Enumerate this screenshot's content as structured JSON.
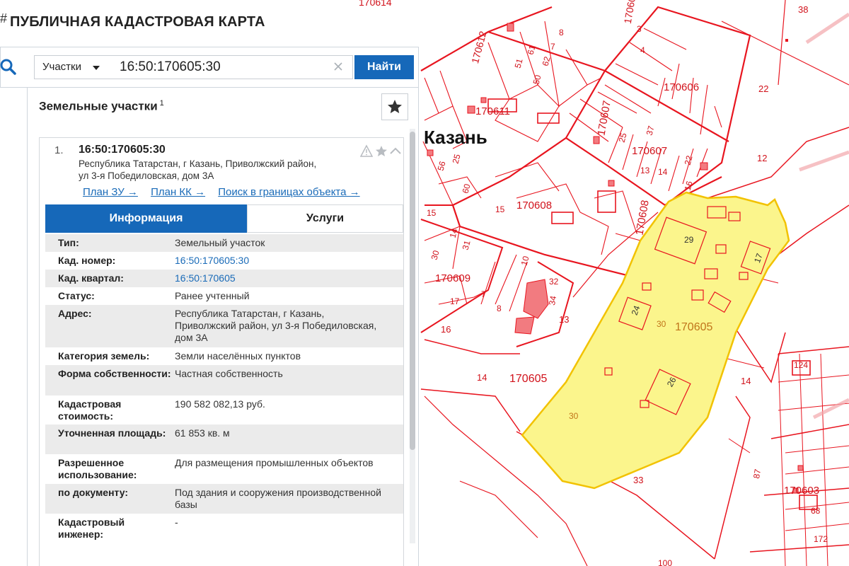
{
  "header": {
    "title": "ПУБЛИЧНАЯ КАДАСТРОВАЯ КАРТА",
    "mark": "#"
  },
  "search": {
    "layer": "Участки",
    "query": "16:50:170605:30",
    "button": "Найти"
  },
  "panel": {
    "title": "Земельные участки",
    "count": "1"
  },
  "result": {
    "index": "1.",
    "cad_number": "16:50:170605:30",
    "address": "Республика Татарстан, г Казань, Приволжский район, ул 3-я Победиловская, дом 3А",
    "links": [
      "План ЗУ →",
      "План КК →",
      "Поиск в границах объекта →"
    ],
    "tabs": {
      "info": "Информация",
      "services": "Услуги"
    },
    "rows": [
      {
        "label": "Тип:",
        "value": "Земельный участок"
      },
      {
        "label": "Кад. номер:",
        "value": "16:50:170605:30"
      },
      {
        "label": "Кад. квартал:",
        "value": "16:50:170605"
      },
      {
        "label": "Статус:",
        "value": "Ранее учтенный"
      },
      {
        "label": "Адрес:",
        "value": "Республика Татарстан, г Казань, Приволжский район, ул 3-я Победиловская, дом 3А"
      },
      {
        "label": "Категория земель:",
        "value": "Земли населённых пунктов"
      },
      {
        "label": "Форма собственности:",
        "value": "Частная собственность"
      },
      {
        "label": "Кадастровая стоимость:",
        "value": "190 582 082,13 руб."
      },
      {
        "label": "Уточненная площадь:",
        "value": "61 853 кв. м"
      },
      {
        "label": "Разрешенное использование:",
        "value": "Для размещения промышленных объектов"
      },
      {
        "label": "по документу:",
        "value": "Под здания и сооружения производственной базы"
      },
      {
        "label": "Кадастровый инженер:",
        "value": "-"
      }
    ]
  },
  "map": {
    "city": "Казань",
    "quarters": [
      "170614",
      "170612",
      "170611",
      "170607",
      "170606",
      "170607",
      "170608",
      "170608",
      "170609",
      "170605",
      "170605",
      "170603",
      "17060"
    ],
    "parcels": [
      "38",
      "22",
      "12",
      "29",
      "17",
      "24",
      "30",
      "30",
      "26",
      "30",
      "33",
      "14",
      "14",
      "13",
      "16",
      "32",
      "34",
      "15",
      "124",
      "87",
      "68",
      "172",
      "100",
      "56",
      "25",
      "60",
      "15",
      "14",
      "30",
      "31",
      "17",
      "7",
      "8",
      "10",
      "51",
      "50",
      "62",
      "61",
      "7",
      "8",
      "3",
      "4",
      "25",
      "37",
      "13",
      "22",
      "14",
      "16"
    ],
    "colors": {
      "boundary": "#e8151f",
      "selected_fill": "#fbf58c",
      "selected_stroke": "#f2c200",
      "building_fill": "#f27b80"
    }
  }
}
